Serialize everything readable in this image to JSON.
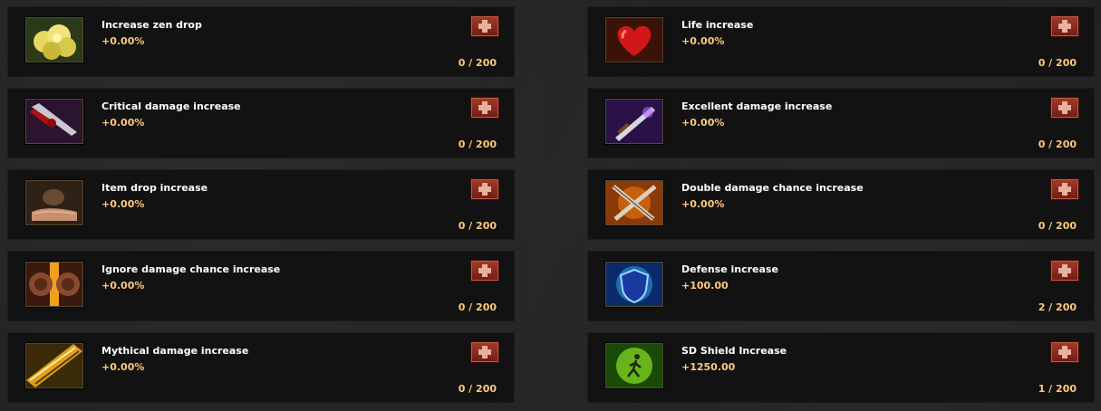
{
  "add_icon": "plus-cross-icon",
  "colors": {
    "title": "#ffffff",
    "value": "#ffc97a",
    "add_button": "#8b2b1e"
  },
  "skills": [
    {
      "name": "Increase zen drop",
      "bonus": "+0.00%",
      "count": "0 / 200",
      "icon": "zen-coins-icon"
    },
    {
      "name": "Life increase",
      "bonus": "+0.00%",
      "count": "0 / 200",
      "icon": "heart-icon"
    },
    {
      "name": "Critical damage increase",
      "bonus": "+0.00%",
      "count": "0 / 200",
      "icon": "bloody-blade-icon"
    },
    {
      "name": "Excellent damage increase",
      "bonus": "+0.00%",
      "count": "0 / 200",
      "icon": "sword-icon"
    },
    {
      "name": "Item drop increase",
      "bonus": "+0.00%",
      "count": "0 / 200",
      "icon": "hand-bag-icon"
    },
    {
      "name": "Double damage chance increase",
      "bonus": "+0.00%",
      "count": "0 / 200",
      "icon": "crossed-swords-icon"
    },
    {
      "name": "Ignore damage chance increase",
      "bonus": "+0.00%",
      "count": "0 / 200",
      "icon": "shield-clash-icon"
    },
    {
      "name": "Defense increase",
      "bonus": "+100.00",
      "count": "2 / 200",
      "icon": "blue-shield-icon"
    },
    {
      "name": "Mythical damage increase",
      "bonus": "+0.00%",
      "count": "0 / 200",
      "icon": "golden-blade-icon"
    },
    {
      "name": "SD Shield Increase",
      "bonus": "+1250.00",
      "count": "1 / 200",
      "icon": "running-figure-icon"
    }
  ]
}
